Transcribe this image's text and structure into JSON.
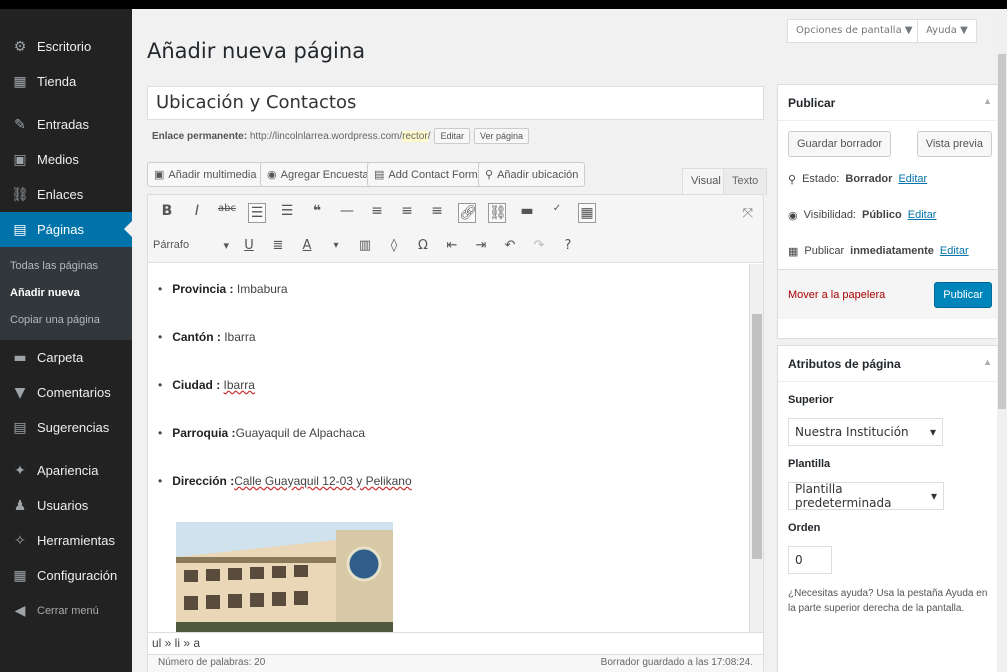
{
  "sidebar": {
    "items": [
      {
        "name": "escritorio",
        "label": "Escritorio",
        "icon": "⚙"
      },
      {
        "name": "tienda",
        "label": "Tienda",
        "icon": "▦"
      },
      {
        "name": "entradas",
        "label": "Entradas",
        "icon": "✎"
      },
      {
        "name": "medios",
        "label": "Medios",
        "icon": "▣"
      },
      {
        "name": "enlaces",
        "label": "Enlaces",
        "icon": "⛓"
      },
      {
        "name": "paginas",
        "label": "Páginas",
        "icon": "▤"
      }
    ],
    "submenu": [
      "Todas las páginas",
      "Añadir nueva",
      "Copiar una página"
    ],
    "items2": [
      {
        "name": "carpeta",
        "label": "Carpeta",
        "icon": "▬"
      },
      {
        "name": "comentarios",
        "label": "Comentarios",
        "icon": "▼"
      },
      {
        "name": "sugerencias",
        "label": "Sugerencias",
        "icon": "▤"
      },
      {
        "name": "apariencia",
        "label": "Apariencia",
        "icon": "✦"
      },
      {
        "name": "usuarios",
        "label": "Usuarios",
        "icon": "♟"
      },
      {
        "name": "herramientas",
        "label": "Herramientas",
        "icon": "✧"
      },
      {
        "name": "configuracion",
        "label": "Configuración",
        "icon": "▦"
      },
      {
        "name": "cerrar",
        "label": "Cerrar menú",
        "icon": "◀"
      }
    ]
  },
  "header": {
    "title": "Añadir nueva página",
    "screen_options": "Opciones de pantalla ▼",
    "help": "Ayuda ▼"
  },
  "editor": {
    "page_title": "Ubicación y Contactos",
    "permalink_label": "Enlace permanente:",
    "permalink_url": "http://lincolnlarrea.wordpress.com/",
    "permalink_slug": "rector",
    "permalink_end": "/",
    "edit": "Editar",
    "view": "Ver página",
    "media_buttons": [
      "Añadir multimedia",
      "Agregar Encuesta",
      "Add Contact Form",
      "Añadir ubicación"
    ],
    "tab_visual": "Visual",
    "tab_text": "Texto",
    "format": "Párrafo",
    "items": [
      {
        "label": "Provincia :",
        "value": "Imbabura"
      },
      {
        "label": "Cantón :",
        "value": "Ibarra"
      },
      {
        "label": "Ciudad :",
        "value": "Ibarra"
      },
      {
        "label": "Parroquia :",
        "value": "Guayaquil de Alpachaca"
      },
      {
        "label": "Dirección :",
        "value": "Calle Guayaquil 12-03 y Pelikano"
      }
    ],
    "path": "ul » li » a",
    "word_count": "Número de palabras: 20",
    "saved": "Borrador guardado a las 17:08:24."
  },
  "publish": {
    "title": "Publicar",
    "save_draft": "Guardar borrador",
    "preview": "Vista previa",
    "status_label": "Estado:",
    "status": "Borrador",
    "visibility_label": "Visibilidad:",
    "visibility": "Público",
    "publish_label": "Publicar",
    "publish_when": "inmediatamente",
    "edit": "Editar",
    "trash": "Mover a la papelera",
    "publish_btn": "Publicar"
  },
  "attributes": {
    "title": "Atributos de página",
    "parent_label": "Superior",
    "parent": "Nuestra Institución",
    "template_label": "Plantilla",
    "template": "Plantilla predeterminada",
    "order_label": "Orden",
    "order": "0",
    "help": "¿Necesitas ayuda? Usa la pestaña Ayuda en la parte superior derecha de la pantalla."
  },
  "colors": {
    "accent": "#0073aa",
    "sidebar": "#222222"
  }
}
